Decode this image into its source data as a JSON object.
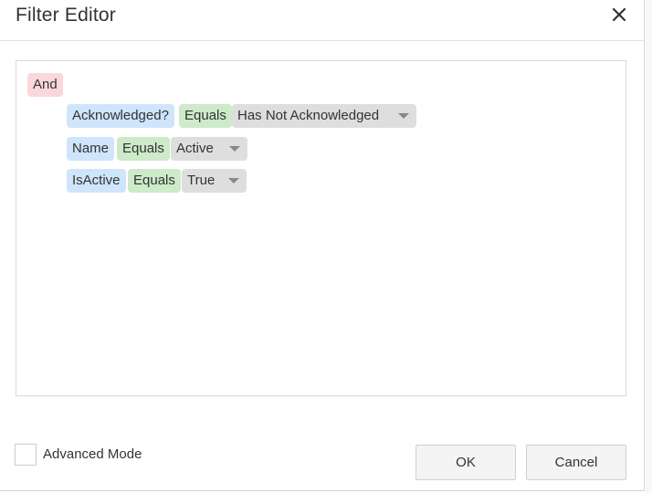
{
  "dialog": {
    "title": "Filter Editor",
    "close_icon": "close-icon"
  },
  "filter": {
    "group_operator": "And",
    "conditions": [
      {
        "field": "Acknowledged?",
        "operator": "Equals",
        "value": "Has Not Acknowledged"
      },
      {
        "field": "Name",
        "operator": "Equals",
        "value": "Active"
      },
      {
        "field": "IsActive",
        "operator": "Equals",
        "value": "True"
      }
    ]
  },
  "footer": {
    "advanced_mode_label": "Advanced Mode",
    "advanced_mode_checked": false,
    "ok_label": "OK",
    "cancel_label": "Cancel"
  },
  "colors": {
    "group_chip": "#fbd7d9",
    "field_chip": "#cfe5fb",
    "operator_chip": "#cdeac9",
    "value_chip": "#dedede"
  }
}
